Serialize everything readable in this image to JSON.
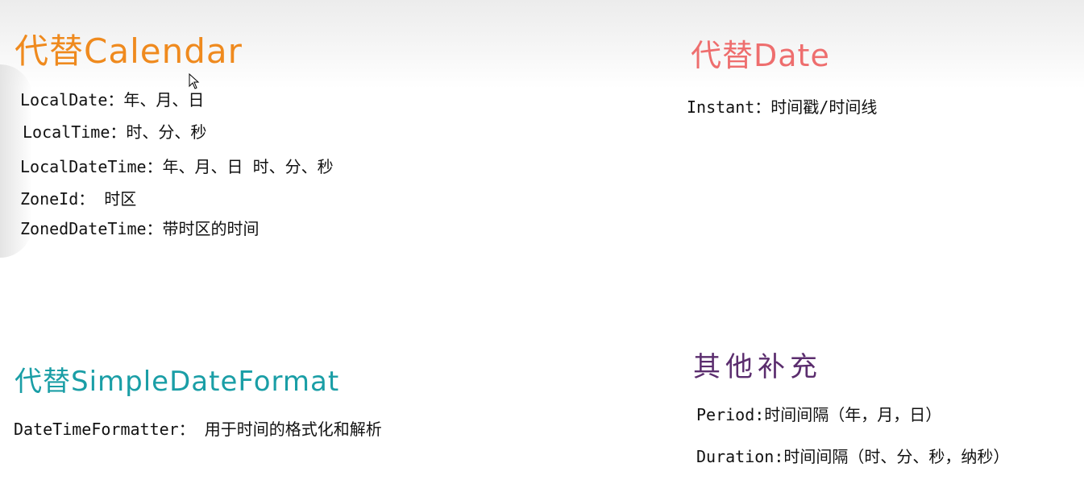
{
  "sections": {
    "calendar": {
      "title": "代替Calendar",
      "items": [
        "LocalDate：年、月、日",
        "LocalTime：时、分、秒",
        "LocalDateTime：年、月、日  时、分、秒",
        "ZoneId： 时区",
        "ZonedDateTime：带时区的时间"
      ]
    },
    "date": {
      "title": "代替Date",
      "items": [
        "Instant：时间戳/时间线"
      ]
    },
    "simple_date_format": {
      "title": "代替SimpleDateFormat",
      "items": [
        "DateTimeFormatter： 用于时间的格式化和解析"
      ]
    },
    "other": {
      "title": "其他补充",
      "items": [
        "Period:时间间隔（年，月，日）",
        "Duration:时间间隔（时、分、秒，纳秒）"
      ]
    }
  },
  "colors": {
    "calendar_title": "#ef8a1e",
    "date_title": "#ee6e6e",
    "sdf_title": "#1a9ea6",
    "other_title": "#5b2d6e"
  },
  "icons": {
    "cursor": "mouse-cursor-icon"
  }
}
